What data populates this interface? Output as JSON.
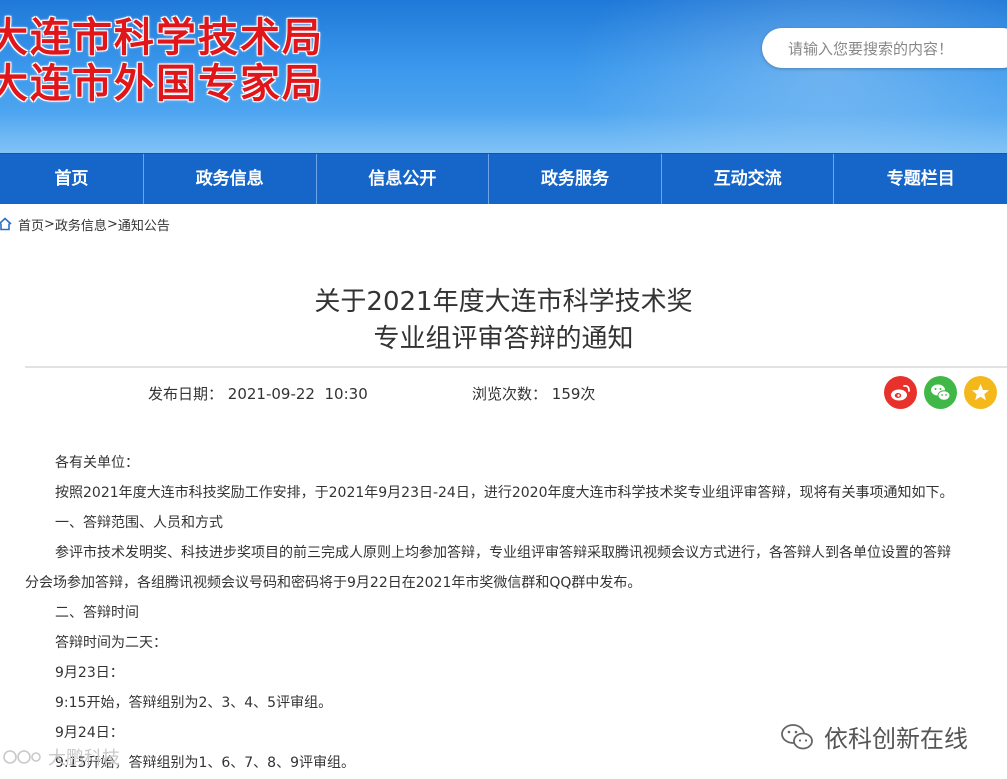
{
  "header": {
    "title_line1": "大连市科学技术局",
    "title_line2": "大连市外国专家局",
    "search_placeholder": "请输入您要搜索的内容！"
  },
  "nav": {
    "items": [
      "首页",
      "政务信息",
      "信息公开",
      "政务服务",
      "互动交流",
      "专题栏目"
    ]
  },
  "breadcrumb": {
    "home": "首页",
    "section": "政务信息",
    "page": "通知公告",
    "separator": ">"
  },
  "article": {
    "title_line1": "关于2021年度大连市科学技术奖",
    "title_line2": "专业组评审答辩的通知",
    "publish_label": "发布日期：",
    "publish_date": "2021-09-22  10:30",
    "views_label": "浏览次数：",
    "views": "159次",
    "paragraphs": [
      "各有关单位：",
      "按照2021年度大连市科技奖励工作安排，于2021年9月23日-24日，进行2020年度大连市科学技术奖专业组评审答辩，现将有关事项通知如下。",
      "一、答辩范围、人员和方式",
      "参评市技术发明奖、科技进步奖项目的前三完成人原则上均参加答辩，专业组评审答辩采取腾讯视频会议方式进行，各答辩人到各单位设置的答辩",
      "分会场参加答辩，各组腾讯视频会议号码和密码将于9月22日在2021年市奖微信群和QQ群中发布。",
      "二、答辩时间",
      "答辩时间为二天：",
      "9月23日：",
      "9:15开始，答辩组别为2、3、4、5评审组。",
      "9月24日：",
      "9:15开始，答辩组别为1、6、7、8、9评审组。"
    ]
  },
  "watermarks": {
    "left": "大鹏科技",
    "right": "依科创新在线"
  },
  "colors": {
    "nav_bg": "#1666c9",
    "title_red": "#e0161b",
    "weibo": "#e8312b",
    "wechat": "#40b848",
    "favorite": "#f5b81b"
  }
}
